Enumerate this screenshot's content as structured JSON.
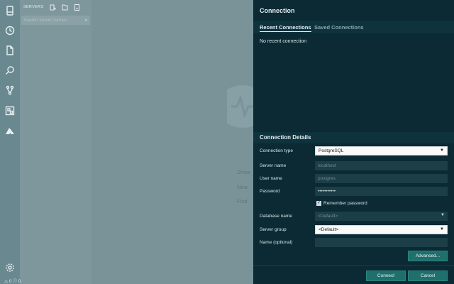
{
  "activity_bar": {
    "icons": [
      "servers-icon",
      "history-icon",
      "file-icon",
      "search-icon",
      "source-control-icon",
      "extensions-icon",
      "azure-icon",
      "settings-icon"
    ]
  },
  "sidebar": {
    "header": "SERVERS",
    "search": {
      "placeholder": "Search server names",
      "clear": "×"
    }
  },
  "welcome": {
    "lines": [
      "Show",
      "New",
      "Find"
    ]
  },
  "status": {
    "text": "⚠ 0 ⓘ 0"
  },
  "dialog": {
    "title": "Connection",
    "tabs": [
      "Recent Connections",
      "Saved Connections"
    ],
    "recent_empty": "No recent connection",
    "details_title": "Connection Details",
    "fields": {
      "connection_type": {
        "label": "Connection type",
        "value": "PostgreSQL"
      },
      "server_name": {
        "label": "Server name",
        "placeholder": "localhost"
      },
      "user_name": {
        "label": "User name",
        "placeholder": "postgres"
      },
      "password": {
        "label": "Password",
        "value": "•••••••••••"
      },
      "remember": {
        "label": "Remember password",
        "checked": true
      },
      "database_name": {
        "label": "Database name",
        "value": "<Default>"
      },
      "server_group": {
        "label": "Server group",
        "value": "<Default>"
      },
      "name_optional": {
        "label": "Name (optional)",
        "value": ""
      }
    },
    "buttons": {
      "advanced": "Advanced...",
      "connect": "Connect",
      "cancel": "Cancel"
    }
  },
  "colors": {
    "dialog_bg": "#0b2a33",
    "button": "#1f6f6c",
    "sidebar": "#7e979d"
  }
}
